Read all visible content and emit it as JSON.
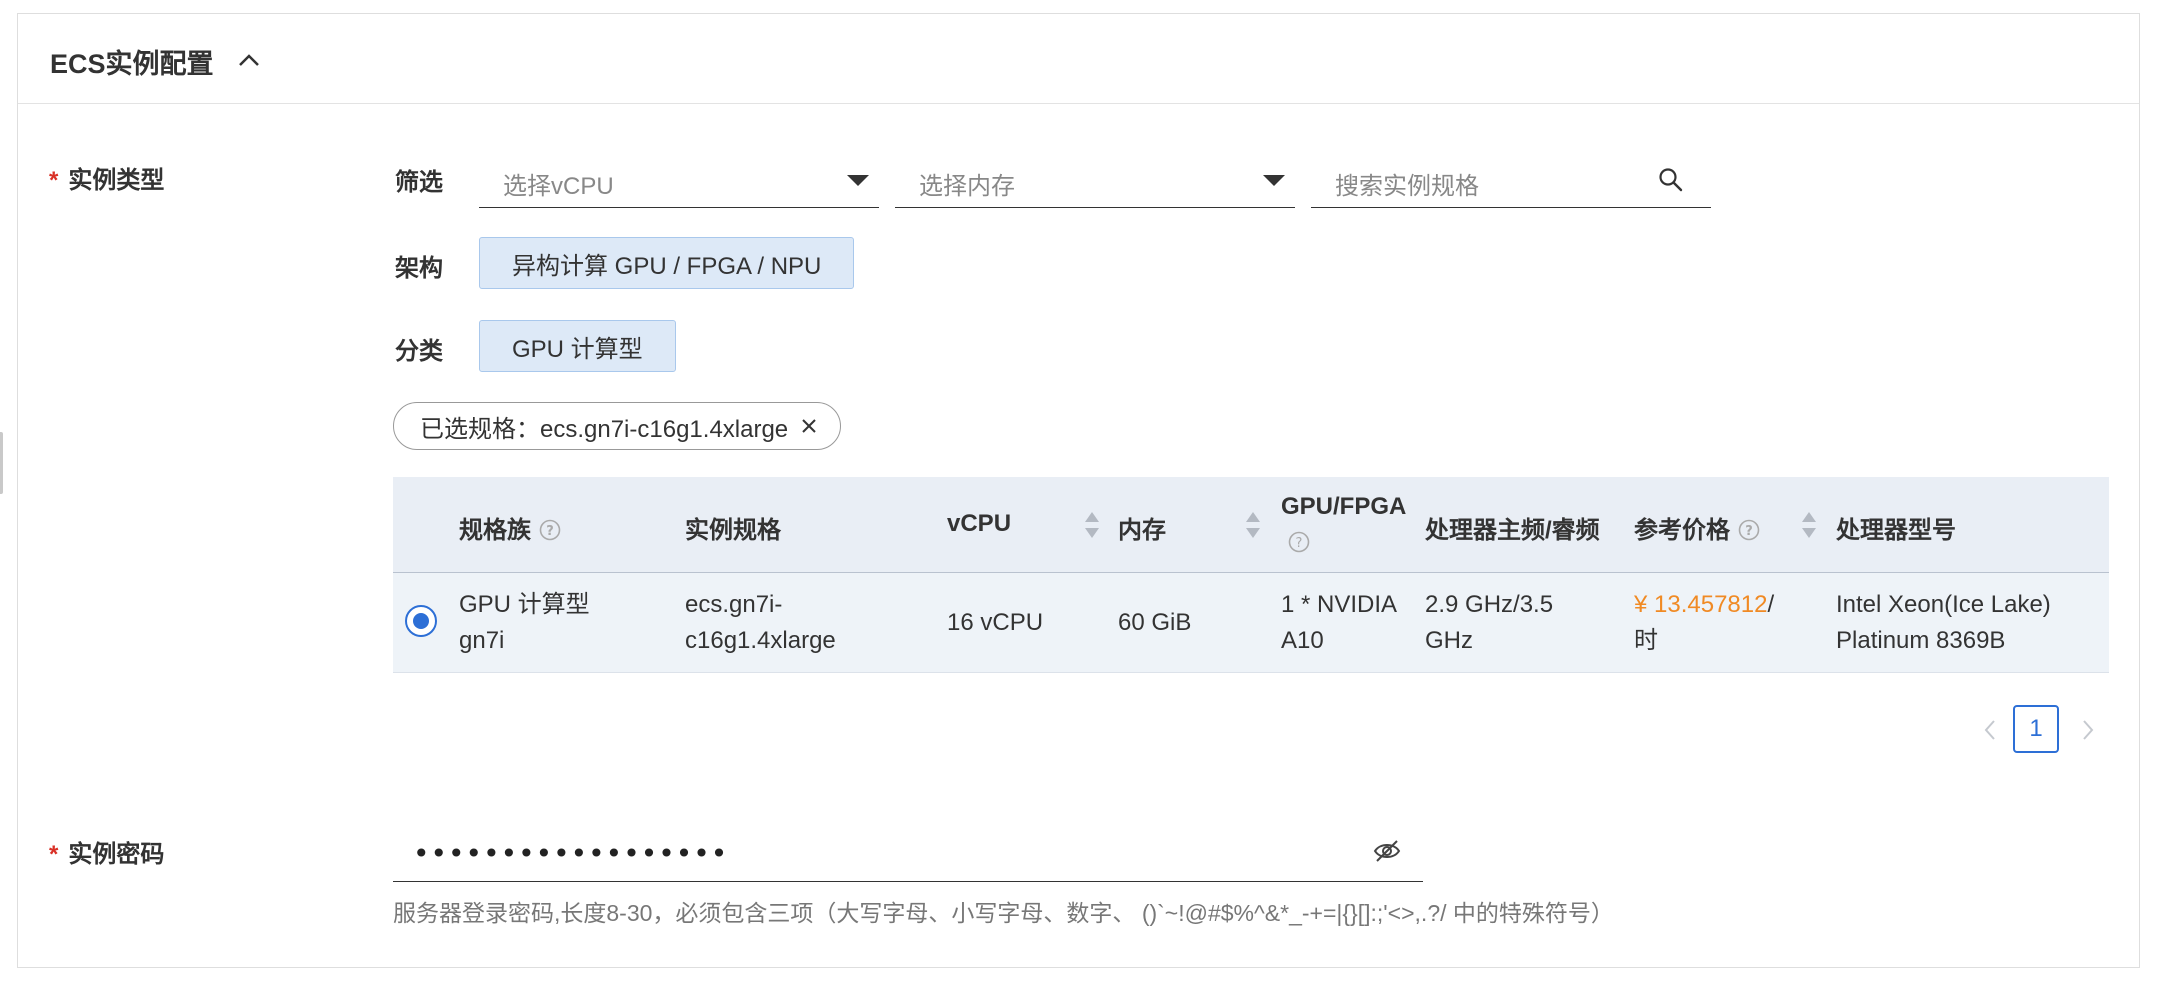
{
  "section": {
    "title": "ECS实例配置"
  },
  "instance_type": {
    "label": "实例类型",
    "required_mark": "*",
    "filter": {
      "label": "筛选",
      "vcpu_placeholder": "选择vCPU",
      "memory_placeholder": "选择内存",
      "search_placeholder": "搜索实例规格"
    },
    "arch": {
      "label": "架构",
      "value": "异构计算 GPU / FPGA / NPU"
    },
    "category": {
      "label": "分类",
      "value": "GPU 计算型"
    },
    "selected": {
      "text": "已选规格：ecs.gn7i-c16g1.4xlarge"
    }
  },
  "table": {
    "headers": {
      "family": "规格族",
      "spec": "实例规格",
      "vcpu": "vCPU",
      "memory": "内存",
      "gpu": "GPU/FPGA",
      "freq": "处理器主频/睿频",
      "price": "参考价格",
      "cpu_model": "处理器型号"
    },
    "rows": [
      {
        "family_l1": "GPU 计算型",
        "family_l2": "gn7i",
        "spec_l1": "ecs.gn7i-",
        "spec_l2": "c16g1.4xlarge",
        "vcpu": "16 vCPU",
        "memory": "60 GiB",
        "gpu_l1": "1 * NVIDIA",
        "gpu_l2": "A10",
        "freq_l1": "2.9 GHz/3.5",
        "freq_l2": "GHz",
        "price_value": "¥ 13.457812",
        "price_sep": "/",
        "price_unit": "时",
        "cpu_l1": "Intel Xeon(Ice Lake)",
        "cpu_l2": "Platinum 8369B",
        "selected": true
      }
    ]
  },
  "pagination": {
    "current": "1"
  },
  "password": {
    "label": "实例密码",
    "required_mark": "*",
    "value": "••••••••••••••••••",
    "hint": "服务器登录密码,长度8-30，必须包含三项（大写字母、小写字母、数字、 ()`~!@#$%^&*_-+=|{}[]:;'<>,.?/ 中的特殊符号）"
  },
  "colors": {
    "primary": "#2d6fd6",
    "price": "#f08a24",
    "required": "#d93026",
    "chip_bg": "#dde9f7"
  }
}
